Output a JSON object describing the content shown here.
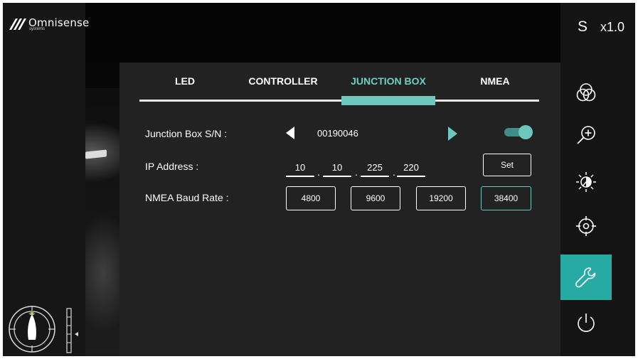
{
  "brand": {
    "name": "Omnisense",
    "sub": "systems"
  },
  "header": {
    "mode": "S",
    "zoom": "x1.0"
  },
  "tabs": [
    {
      "label": "LED"
    },
    {
      "label": "CONTROLLER"
    },
    {
      "label": "JUNCTION BOX",
      "active": true
    },
    {
      "label": "NMEA"
    }
  ],
  "junction": {
    "sn_label": "Junction Box S/N :",
    "sn_value": "00190046",
    "enabled": true
  },
  "ip": {
    "label": "IP Address :",
    "segments": [
      "10",
      "10",
      "225",
      "220"
    ],
    "separator": ".",
    "set_label": "Set"
  },
  "nmea": {
    "label": "NMEA Baud Rate :",
    "options": [
      "4800",
      "9600",
      "19200",
      "38400"
    ],
    "selected": "38400"
  },
  "toolbar": {
    "icons": [
      "color-palette-icon",
      "zoom-in-icon",
      "brightness-contrast-icon",
      "crosshair-target-icon",
      "wrench-settings-icon",
      "power-icon"
    ],
    "active": "wrench-settings-icon"
  },
  "colors": {
    "accent": "#6ec6bc",
    "active_bg": "#27aaa4",
    "panel": "#222222",
    "chrome": "#141414"
  }
}
